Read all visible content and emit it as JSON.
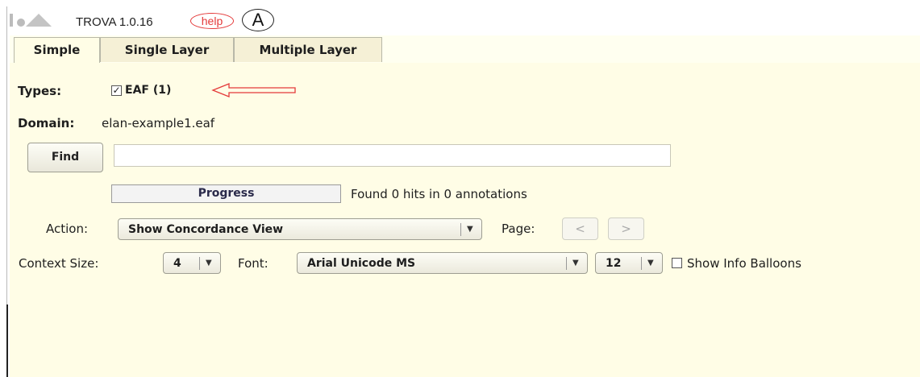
{
  "app": {
    "title": "TROVA 1.0.16",
    "help_label": "help",
    "annotation_letter": "A"
  },
  "tabs": [
    {
      "label": "Simple",
      "active": true
    },
    {
      "label": "Single Layer",
      "active": false
    },
    {
      "label": "Multiple Layer",
      "active": false
    }
  ],
  "types": {
    "label": "Types:",
    "checkbox_checked": true,
    "checkbox_label": "EAF (1)"
  },
  "domain": {
    "label": "Domain:",
    "value": "elan-example1.eaf"
  },
  "find": {
    "button_label": "Find",
    "query_value": ""
  },
  "progress": {
    "label": "Progress",
    "status": "Found 0 hits in 0 annotations"
  },
  "action": {
    "label": "Action:",
    "selected": "Show Concordance View",
    "page_label": "Page:",
    "prev_label": "<",
    "next_label": ">"
  },
  "context": {
    "size_label": "Context Size:",
    "size_value": "4",
    "font_label": "Font:",
    "font_value": "Arial Unicode MS",
    "font_size_value": "12",
    "info_balloons_checked": false,
    "info_balloons_label": "Show Info Balloons"
  },
  "colors": {
    "panel_bg": "#fffde6",
    "annotation_red": "#e43a3a"
  },
  "icons": [
    "app-logo-icon",
    "checkmark-icon",
    "dropdown-arrow-icon"
  ]
}
